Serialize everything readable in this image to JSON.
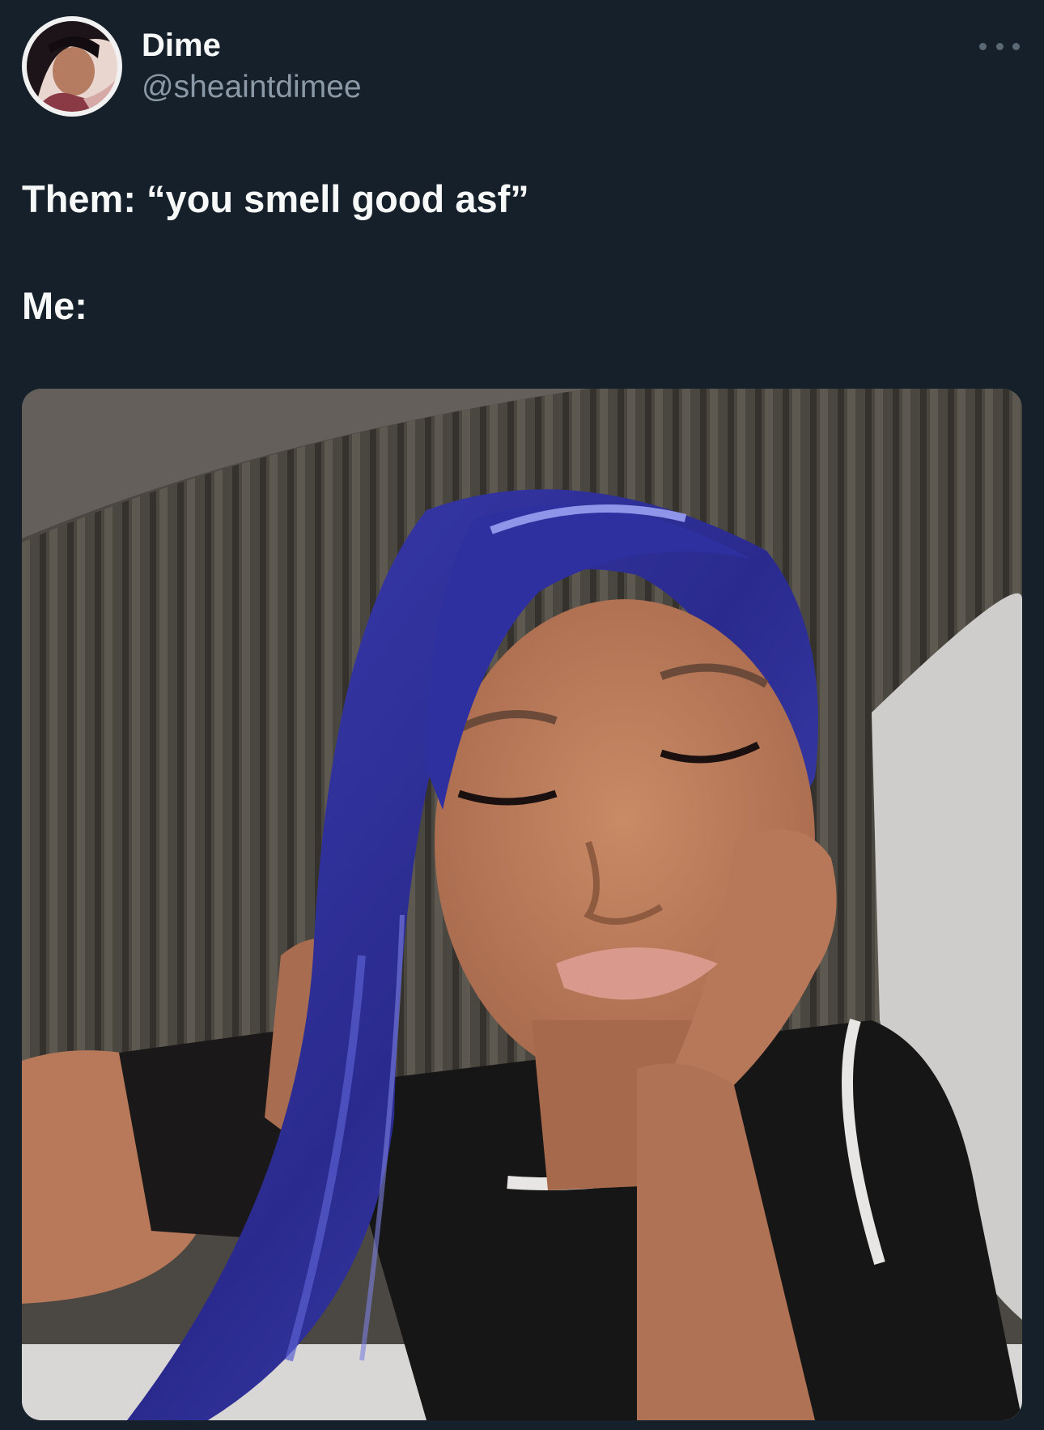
{
  "tweet": {
    "author": {
      "display_name": "Dime",
      "handle": "@sheaintdimee",
      "avatar_icon": "profile-photo-avatar"
    },
    "more_icon": "more-horizontal-icon",
    "text_lines": [
      "Them: “you smell good asf”",
      "Me:"
    ],
    "media": {
      "type": "photo"
    }
  },
  "theme": {
    "background": "#15202b",
    "text_primary": "#f7f9f9",
    "text_secondary": "#8b98a5",
    "icon_muted": "#5b6976"
  }
}
